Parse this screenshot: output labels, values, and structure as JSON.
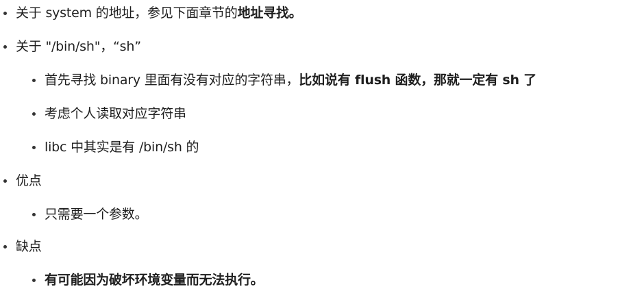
{
  "items": [
    {
      "level": 1,
      "parts": [
        {
          "text": "关于 system 的地址，参见下面章节的",
          "bold": false
        },
        {
          "text": "地址寻找。",
          "bold": true
        }
      ]
    },
    {
      "level": 1,
      "parts": [
        {
          "text": "关于 \"/bin/sh\"，“sh”",
          "bold": false
        }
      ]
    },
    {
      "level": 2,
      "parts": [
        {
          "text": "首先寻找 binary 里面有没有对应的字符串，",
          "bold": false
        },
        {
          "text": "比如说有 flush 函数，那就一定有 sh 了",
          "bold": true
        }
      ]
    },
    {
      "level": 2,
      "parts": [
        {
          "text": "考虑个人读取对应字符串",
          "bold": false
        }
      ]
    },
    {
      "level": 2,
      "parts": [
        {
          "text": "libc 中其实是有 /bin/sh 的",
          "bold": false
        }
      ]
    },
    {
      "level": 1,
      "parts": [
        {
          "text": "优点",
          "bold": false
        }
      ]
    },
    {
      "level": 2,
      "parts": [
        {
          "text": "只需要一个参数。",
          "bold": false
        }
      ]
    },
    {
      "level": 1,
      "parts": [
        {
          "text": "缺点",
          "bold": false
        }
      ]
    },
    {
      "level": 2,
      "parts": [
        {
          "text": "有可能因为破坏环境变量而无法执行。",
          "bold": true
        }
      ]
    }
  ]
}
